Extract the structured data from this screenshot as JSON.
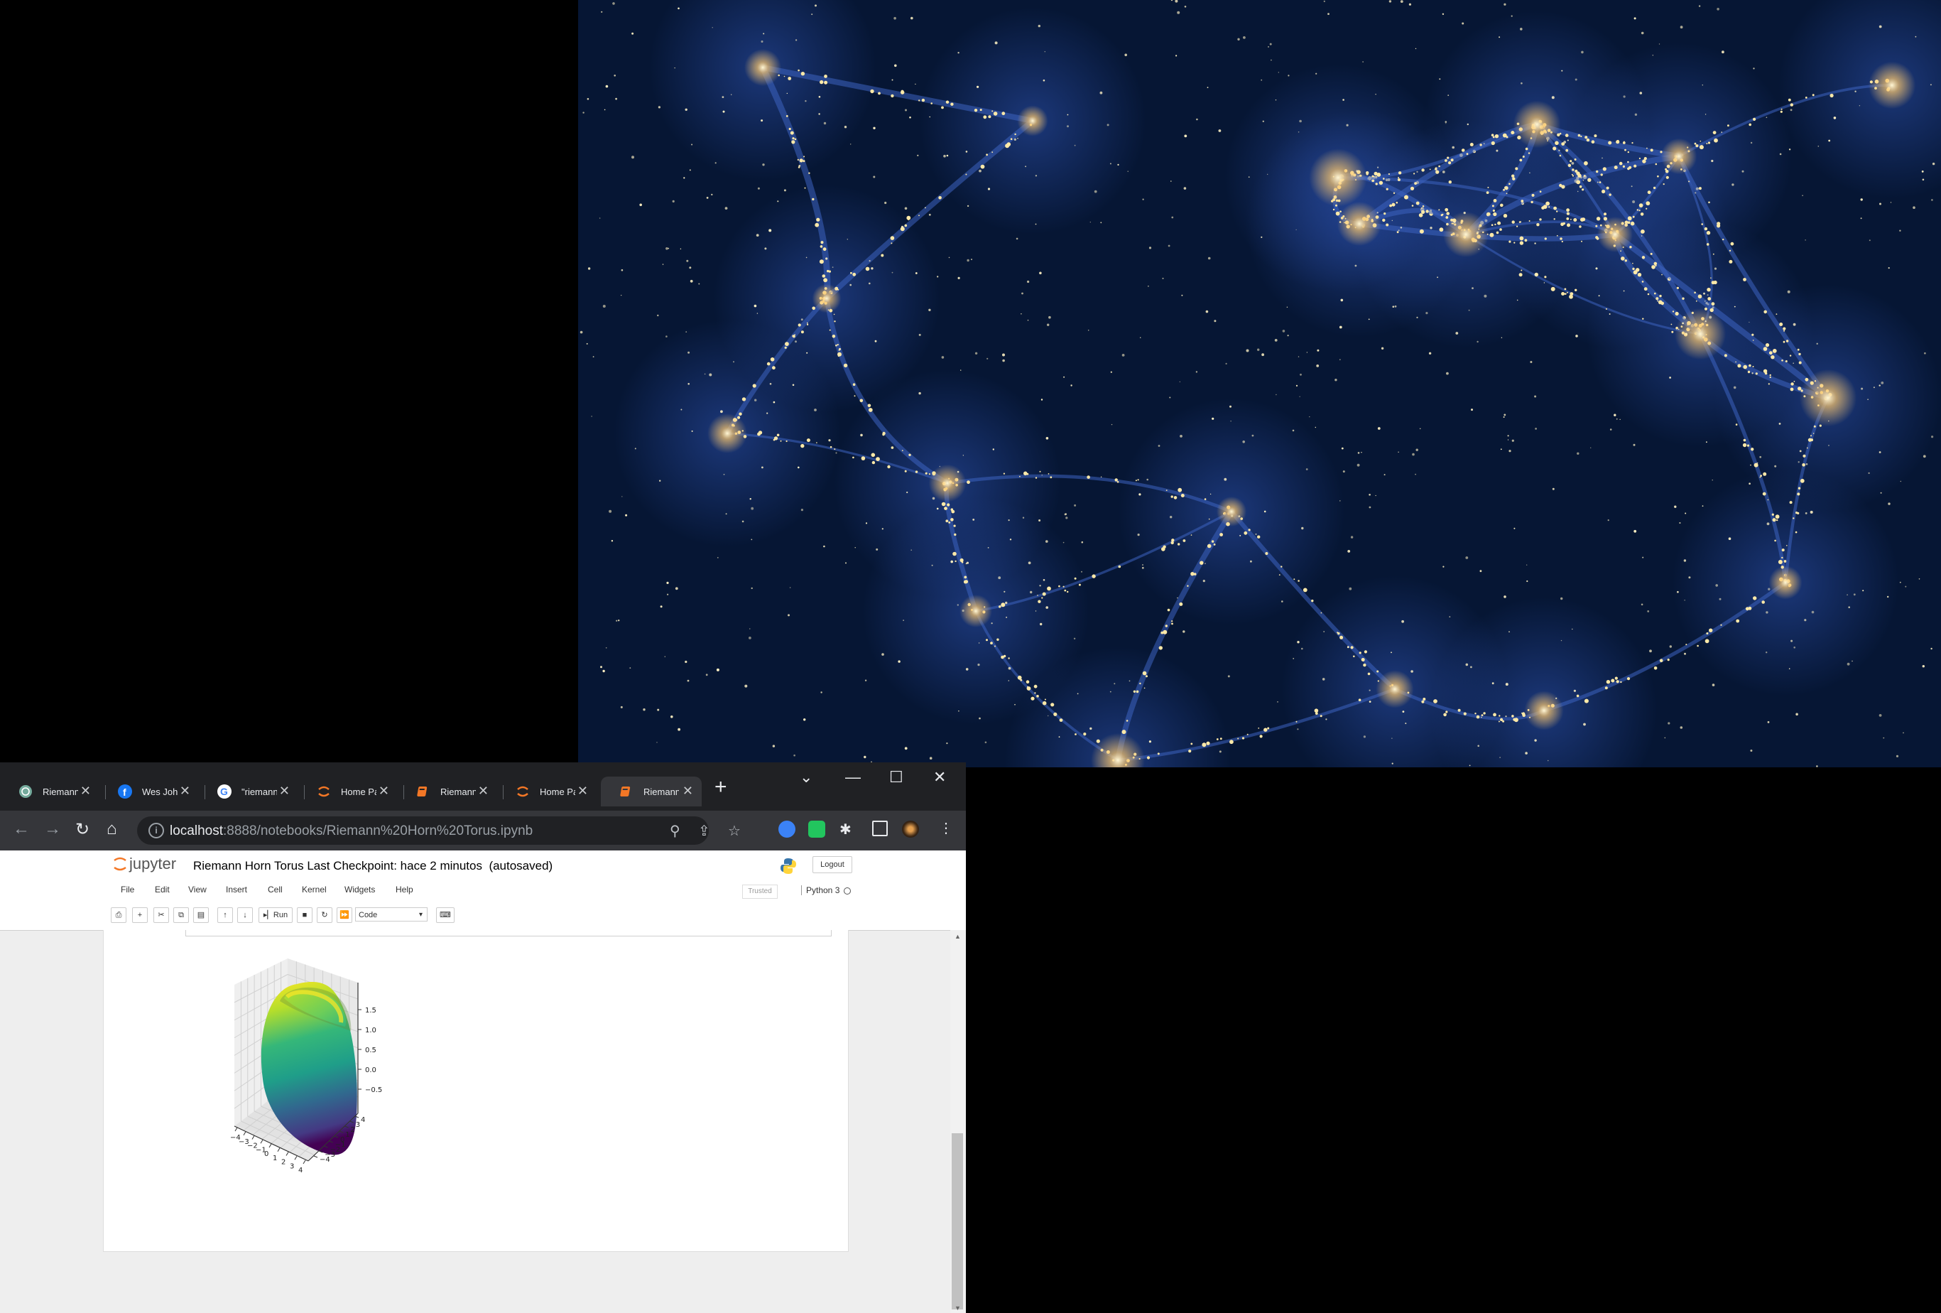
{
  "tabs": [
    {
      "label": "Riemann",
      "icon": "openai-icon"
    },
    {
      "label": "Wes John",
      "icon": "facebook-icon"
    },
    {
      "label": "\"riemann",
      "icon": "google-icon"
    },
    {
      "label": "Home Pa",
      "icon": "jupyter-icon"
    },
    {
      "label": "Riemann",
      "icon": "notebook-icon"
    },
    {
      "label": "Home Pa",
      "icon": "jupyter-icon"
    },
    {
      "label": "Riemann",
      "icon": "notebook-icon"
    }
  ],
  "address": {
    "host": "localhost",
    "rest": ":8888/notebooks/Riemann%20Horn%20Torus.ipynb"
  },
  "jupyter": {
    "logo_text": "jupyter",
    "notebook_name": "Riemann Horn Torus",
    "checkpoint": "Last Checkpoint: hace 2 minutos",
    "autosave": "(autosaved)",
    "logout": "Logout",
    "menu": [
      "File",
      "Edit",
      "View",
      "Insert",
      "Cell",
      "Kernel",
      "Widgets",
      "Help"
    ],
    "trusted": "Trusted",
    "kernel": "Python 3",
    "run_label": "Run",
    "cell_type": "Code"
  },
  "chart_data": {
    "type": "surface3d",
    "title": "",
    "z_ticks": [
      "1.5",
      "1.0",
      "0.5",
      "0.0",
      "−0.5"
    ],
    "x_ticks": [
      "−4",
      "−3",
      "−2",
      "−1",
      "0",
      "1",
      "2",
      "3",
      "4"
    ],
    "y_ticks": [
      "−4",
      "−3",
      "−2",
      "−1",
      "0",
      "1",
      "2",
      "3",
      "4"
    ],
    "colormap": "viridis"
  }
}
